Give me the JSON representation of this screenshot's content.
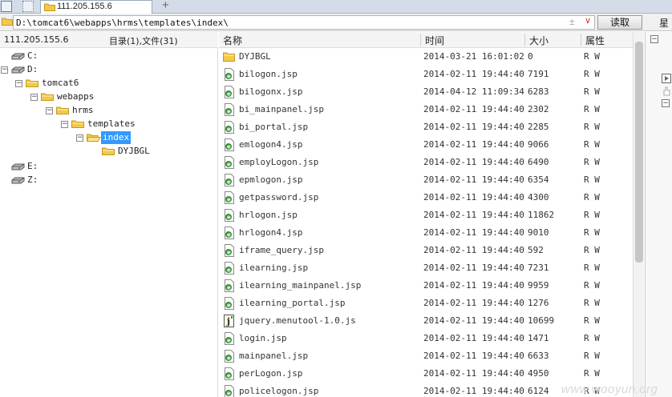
{
  "tabs": {
    "active_label": "111.205.155.6",
    "add_label": "+"
  },
  "address": {
    "path": "D:\\tomcat6\\webapps\\hrms\\templates\\index\\",
    "plus_glyph": "±",
    "dropdown_glyph": "∨",
    "read_button": "读取",
    "right_label": "星"
  },
  "tree_header": {
    "host": "111.205.155.6",
    "count": "目录(1),文件(31)"
  },
  "tree": [
    {
      "label": "C:",
      "type": "drive",
      "depth": 0,
      "expander": ""
    },
    {
      "label": "D:",
      "type": "drive",
      "depth": 0,
      "expander": "−"
    },
    {
      "label": "tomcat6",
      "type": "folder",
      "depth": 1,
      "expander": "−"
    },
    {
      "label": "webapps",
      "type": "folder",
      "depth": 2,
      "expander": "−"
    },
    {
      "label": "hrms",
      "type": "folder",
      "depth": 3,
      "expander": "−"
    },
    {
      "label": "templates",
      "type": "folder",
      "depth": 4,
      "expander": "−"
    },
    {
      "label": "index",
      "type": "folder-open",
      "depth": 5,
      "expander": "−",
      "selected": true
    },
    {
      "label": "DYJBGL",
      "type": "folder",
      "depth": 6,
      "expander": ""
    },
    {
      "label": "E:",
      "type": "drive",
      "depth": 0,
      "expander": ""
    },
    {
      "label": "Z:",
      "type": "drive",
      "depth": 0,
      "expander": ""
    }
  ],
  "columns": {
    "name": "名称",
    "time": "时间",
    "size": "大小",
    "attr": "属性"
  },
  "files": [
    {
      "name": "DYJBGL",
      "time": "2014-03-21 16:01:02",
      "size": "0",
      "attr": "R W",
      "icon": "folder"
    },
    {
      "name": "bilogon.jsp",
      "time": "2014-02-11 19:44:40",
      "size": "7191",
      "attr": "R W",
      "icon": "jsp"
    },
    {
      "name": "bilogonx.jsp",
      "time": "2014-04-12 11:09:34",
      "size": "6283",
      "attr": "R W",
      "icon": "jsp"
    },
    {
      "name": "bi_mainpanel.jsp",
      "time": "2014-02-11 19:44:40",
      "size": "2302",
      "attr": "R W",
      "icon": "jsp"
    },
    {
      "name": "bi_portal.jsp",
      "time": "2014-02-11 19:44:40",
      "size": "2285",
      "attr": "R W",
      "icon": "jsp"
    },
    {
      "name": "emlogon4.jsp",
      "time": "2014-02-11 19:44:40",
      "size": "9066",
      "attr": "R W",
      "icon": "jsp"
    },
    {
      "name": "employLogon.jsp",
      "time": "2014-02-11 19:44:40",
      "size": "6490",
      "attr": "R W",
      "icon": "jsp"
    },
    {
      "name": "epmlogon.jsp",
      "time": "2014-02-11 19:44:40",
      "size": "6354",
      "attr": "R W",
      "icon": "jsp"
    },
    {
      "name": "getpassword.jsp",
      "time": "2014-02-11 19:44:40",
      "size": "4300",
      "attr": "R W",
      "icon": "jsp"
    },
    {
      "name": "hrlogon.jsp",
      "time": "2014-02-11 19:44:40",
      "size": "11862",
      "attr": "R W",
      "icon": "jsp"
    },
    {
      "name": "hrlogon4.jsp",
      "time": "2014-02-11 19:44:40",
      "size": "9010",
      "attr": "R W",
      "icon": "jsp"
    },
    {
      "name": "iframe_query.jsp",
      "time": "2014-02-11 19:44:40",
      "size": "592",
      "attr": "R W",
      "icon": "jsp"
    },
    {
      "name": "ilearning.jsp",
      "time": "2014-02-11 19:44:40",
      "size": "7231",
      "attr": "R W",
      "icon": "jsp"
    },
    {
      "name": "ilearning_mainpanel.jsp",
      "time": "2014-02-11 19:44:40",
      "size": "9959",
      "attr": "R W",
      "icon": "jsp"
    },
    {
      "name": "ilearning_portal.jsp",
      "time": "2014-02-11 19:44:40",
      "size": "1276",
      "attr": "R W",
      "icon": "jsp"
    },
    {
      "name": "jquery.menutool-1.0.js",
      "time": "2014-02-11 19:44:40",
      "size": "10699",
      "attr": "R W",
      "icon": "js"
    },
    {
      "name": "login.jsp",
      "time": "2014-02-11 19:44:40",
      "size": "1471",
      "attr": "R W",
      "icon": "jsp"
    },
    {
      "name": "mainpanel.jsp",
      "time": "2014-02-11 19:44:40",
      "size": "6633",
      "attr": "R W",
      "icon": "jsp"
    },
    {
      "name": "perLogon.jsp",
      "time": "2014-02-11 19:44:40",
      "size": "4950",
      "attr": "R W",
      "icon": "jsp"
    },
    {
      "name": "policelogon.jsp",
      "time": "2014-02-11 19:44:40",
      "size": "6124",
      "attr": "R W",
      "icon": "jsp"
    }
  ],
  "side_panel": {
    "box_glyph": "−"
  },
  "watermark": "www.wooyun.org",
  "colors": {
    "selection": "#3399ff",
    "folder": "#f2c94c",
    "jsp_icon": "#3a8f3a"
  }
}
